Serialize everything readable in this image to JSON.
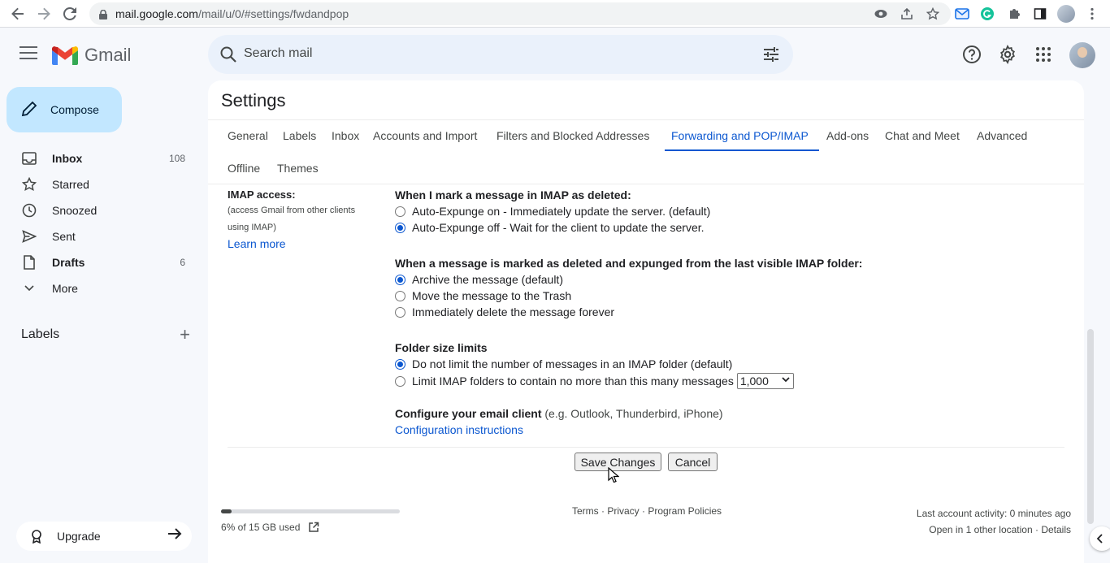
{
  "browser": {
    "url_host": "mail.google.com",
    "url_path": "/mail/u/0/#settings/fwdandpop"
  },
  "header": {
    "app_name": "Gmail",
    "search_placeholder": "Search mail"
  },
  "sidebar": {
    "compose_label": "Compose",
    "items": [
      {
        "label": "Inbox",
        "count": "108",
        "icon": "inbox-icon",
        "bold": true
      },
      {
        "label": "Starred",
        "count": "",
        "icon": "star-icon",
        "bold": false
      },
      {
        "label": "Snoozed",
        "count": "",
        "icon": "clock-icon",
        "bold": false
      },
      {
        "label": "Sent",
        "count": "",
        "icon": "send-icon",
        "bold": false
      },
      {
        "label": "Drafts",
        "count": "6",
        "icon": "draft-icon",
        "bold": true
      },
      {
        "label": "More",
        "count": "",
        "icon": "chevron-down-icon",
        "bold": false
      }
    ],
    "labels_heading": "Labels",
    "upgrade_label": "Upgrade"
  },
  "settings": {
    "title": "Settings",
    "tabs": [
      "General",
      "Labels",
      "Inbox",
      "Accounts and Import",
      "Filters and Blocked Addresses",
      "Forwarding and POP/IMAP",
      "Add-ons",
      "Chat and Meet",
      "Advanced",
      "Offline",
      "Themes"
    ],
    "active_tab": "Forwarding and POP/IMAP",
    "imap": {
      "heading": "IMAP access:",
      "sub1": "(access Gmail from other clients",
      "sub2": "using IMAP)",
      "learn_more": "Learn more",
      "deleted_title": "When I mark a message in IMAP as deleted:",
      "deleted_opt1": "Auto-Expunge on - Immediately update the server. (default)",
      "deleted_opt2": "Auto-Expunge off - Wait for the client to update the server.",
      "expunged_title": "When a message is marked as deleted and expunged from the last visible IMAP folder:",
      "expunged_opt1": "Archive the message (default)",
      "expunged_opt2": "Move the message to the Trash",
      "expunged_opt3": "Immediately delete the message forever",
      "folder_title": "Folder size limits",
      "folder_opt1": "Do not limit the number of messages in an IMAP folder (default)",
      "folder_opt2": "Limit IMAP folders to contain no more than this many messages",
      "folder_limit_value": "1,000",
      "config_title": "Configure your email client",
      "config_note": "(e.g. Outlook, Thunderbird, iPhone)",
      "config_link": "Configuration instructions"
    },
    "save_label": "Save Changes",
    "cancel_label": "Cancel"
  },
  "footer": {
    "storage_text": "6% of 15 GB used",
    "storage_fraction": 0.06,
    "links": "Terms · Privacy · Program Policies",
    "activity_line1": "Last account activity: 0 minutes ago",
    "activity_line2": "Open in 1 other location · Details"
  },
  "colors": {
    "accent": "#0b57d0",
    "compose_bg": "#c2e7ff",
    "page_bg": "#f6f8fc"
  }
}
